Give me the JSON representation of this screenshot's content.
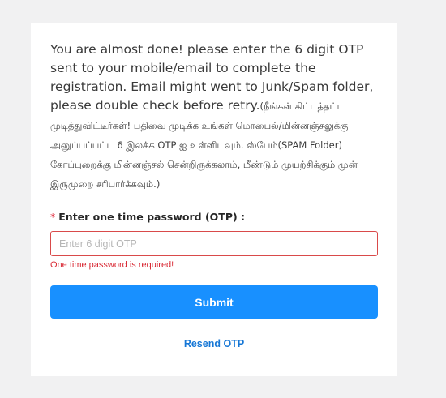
{
  "message": {
    "english": "You are almost done! please enter the 6 digit OTP sent to your mobile/email to complete the registration. Email might went to Junk/Spam folder, please double check before retry.",
    "tamil": "(நீங்கள் கிட்டத்தட்ட முடித்துவிட்டீர்கள்! பதிவை முடிக்க உங்கள் மொபைல்/மின்னஞ்சலுக்கு அனுப்பப்பட்ட 6 இலக்க OTP ஐ உள்ளிடவும். ஸ்பேம்(SPAM Folder) கோப்புறைக்கு மின்னஞ்சல் சென்றிருக்கலாம், மீண்டும் முயற்சிக்கும் முன் இருமுறை சரிபார்க்கவும்.)"
  },
  "form": {
    "required_mark": "*",
    "otp_label": "Enter one time password (OTP) :",
    "otp_placeholder": "Enter 6 digit OTP",
    "otp_value": "",
    "otp_error": "One time password is required!",
    "submit_label": "Submit",
    "resend_label": "Resend OTP"
  },
  "colors": {
    "primary": "#1890ff",
    "error": "#d92a35",
    "link": "#1677d6",
    "background": "#f1f1f2"
  }
}
